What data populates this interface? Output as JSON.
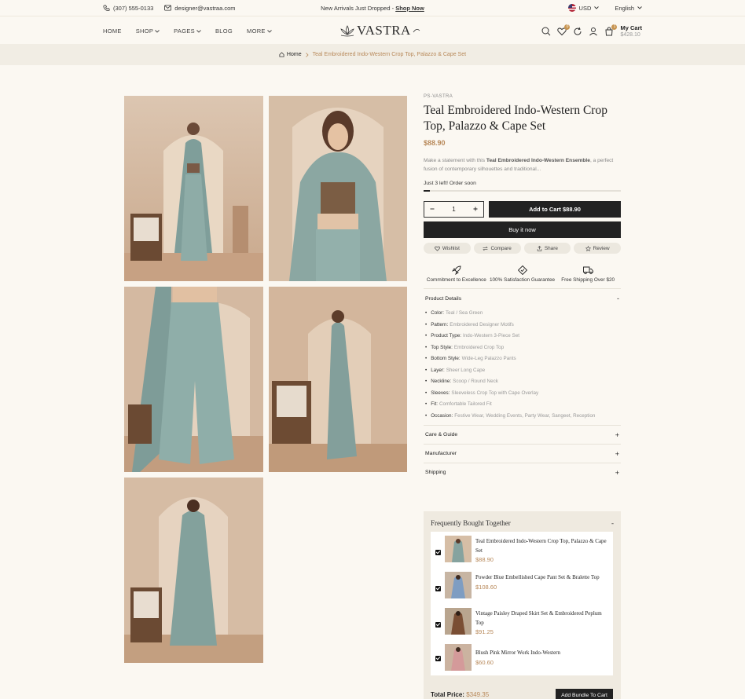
{
  "topbar": {
    "phone": "(307) 555-0133",
    "email": "designer@vastraa.com",
    "announcement": "New Arrivals Just Dropped -",
    "announcement_link": "Shop Now",
    "currency": "USD",
    "language": "English"
  },
  "nav": {
    "items": [
      {
        "label": "HOME",
        "dropdown": false
      },
      {
        "label": "SHOP",
        "dropdown": true
      },
      {
        "label": "PAGES",
        "dropdown": true
      },
      {
        "label": "BLOG",
        "dropdown": false
      },
      {
        "label": "MORE",
        "dropdown": true
      }
    ],
    "logo_text": "VASTRA",
    "wishlist_count": "0",
    "cart_count": "1",
    "cart_label": "My Cart",
    "cart_total": "$428.10"
  },
  "breadcrumb": {
    "home": "Home",
    "current": "Teal Embroidered Indo-Western Crop Top, Palazzo & Cape Set"
  },
  "product": {
    "sku": "PS-VASTRA",
    "title": "Teal Embroidered Indo-Western Crop Top, Palazzo & Cape Set",
    "price": "$88.90",
    "desc_pre": "Make a statement with this ",
    "desc_bold": "Teal Embroidered Indo-Western Ensemble",
    "desc_post": ", a perfect fusion of contemporary silhouettes and traditional...",
    "stock_text": "Just 3 left! Order soon",
    "stock_fraction": 0.03,
    "quantity": "1",
    "add_to_cart": "Add to Cart $88.90",
    "buy_now": "Buy it now",
    "actions": [
      "Wishlist",
      "Compare",
      "Share",
      "Review"
    ]
  },
  "features": [
    {
      "icon": "rocket-icon",
      "text": "Commitment to Excellence"
    },
    {
      "icon": "badge-check-icon",
      "text": "100% Satisfaction Guarantee"
    },
    {
      "icon": "truck-icon",
      "text": "Free Shipping Over $20"
    }
  ],
  "details": {
    "title": "Product Details",
    "toggle": "-",
    "items": [
      {
        "k": "Color:",
        "v": "Teal / Sea Green"
      },
      {
        "k": "Pattern:",
        "v": "Embroidered Designer Motifs"
      },
      {
        "k": "Product Type:",
        "v": "Indo-Western 3-Piece Set"
      },
      {
        "k": "Top Style:",
        "v": "Embroidered Crop Top"
      },
      {
        "k": "Bottom Style:",
        "v": "Wide-Leg Palazzo Pants"
      },
      {
        "k": "Layer:",
        "v": "Sheer Long Cape"
      },
      {
        "k": "Neckline:",
        "v": "Scoop / Round Neck"
      },
      {
        "k": "Sleeves:",
        "v": "Sleeveless Crop Top with Cape Overlay"
      },
      {
        "k": "Fit:",
        "v": "Comfortable Tailored Fit"
      },
      {
        "k": "Occasion:",
        "v": "Festive Wear, Wedding Events, Party Wear, Sangeet, Reception"
      }
    ]
  },
  "accordions": [
    {
      "label": "Care & Guide",
      "toggle": "+"
    },
    {
      "label": "Manufacturer",
      "toggle": "+"
    },
    {
      "label": "Shipping",
      "toggle": "+"
    }
  ],
  "fbt": {
    "title": "Frequently Bought Together",
    "toggle": "-",
    "items": [
      {
        "name": "Teal Embroidered Indo-Western Crop Top, Palazzo & Cape Set",
        "price": "$88.90",
        "checked": true
      },
      {
        "name": "Powder Blue Embellished Cape Pant Set & Bralette Top",
        "price": "$108.60",
        "checked": true
      },
      {
        "name": "Vintage Paisley Draped Skirt Set & Embroidered Peplum Top",
        "price": "$91.25",
        "checked": true
      },
      {
        "name": "Blush Pink Mirror Work Indo-Western",
        "price": "$60.60",
        "checked": true
      }
    ],
    "total_label": "Total Price:",
    "total_value": "$349.35",
    "bundle_button": "Add Bundle To Cart"
  },
  "colors": {
    "accent": "#b8895a",
    "dark": "#222222",
    "bg": "#fbf8f2"
  }
}
